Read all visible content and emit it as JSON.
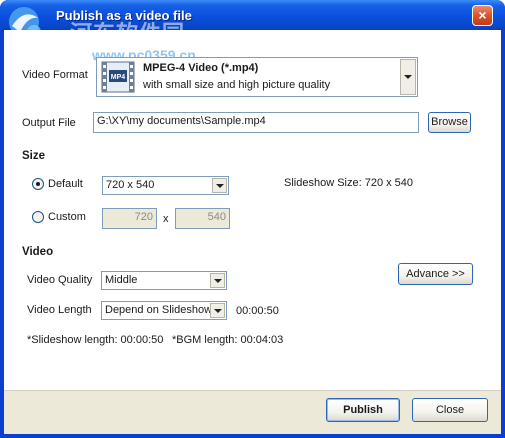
{
  "window": {
    "title": "Publish as a video file",
    "close_label": "×",
    "watermark": "河东软件园",
    "watermark_url": "www.pc0359.cn"
  },
  "video_format": {
    "label": "Video Format",
    "icon_label": "MP4",
    "name": "MPEG-4 Video (*.mp4)",
    "description": "with small size and high picture quality"
  },
  "output_file": {
    "label": "Output File",
    "value": "G:\\XY\\my documents\\Sample.mp4",
    "browse_label": "Browse"
  },
  "size": {
    "heading": "Size",
    "default_label": "Default",
    "default_selected": true,
    "default_value": "720 x 540",
    "custom_label": "Custom",
    "custom_width": "720",
    "custom_x": "x",
    "custom_height": "540",
    "slideshow_size": "Slideshow Size: 720 x 540"
  },
  "video": {
    "heading": "Video",
    "quality_label": "Video Quality",
    "quality_value": "Middle",
    "advance_label": "Advance >>",
    "length_label": "Video Length",
    "length_value": "Depend on Slideshow",
    "length_time": "00:00:50",
    "slideshow_length": "*Slideshow length: 00:00:50",
    "bgm_length": "*BGM length: 00:04:03"
  },
  "footer": {
    "publish_label": "Publish",
    "close_label": "Close"
  },
  "colors": {
    "titlebar": "#0a4fdc",
    "accent_border": "#7f9db9",
    "dialog_face": "#ece9d8"
  }
}
